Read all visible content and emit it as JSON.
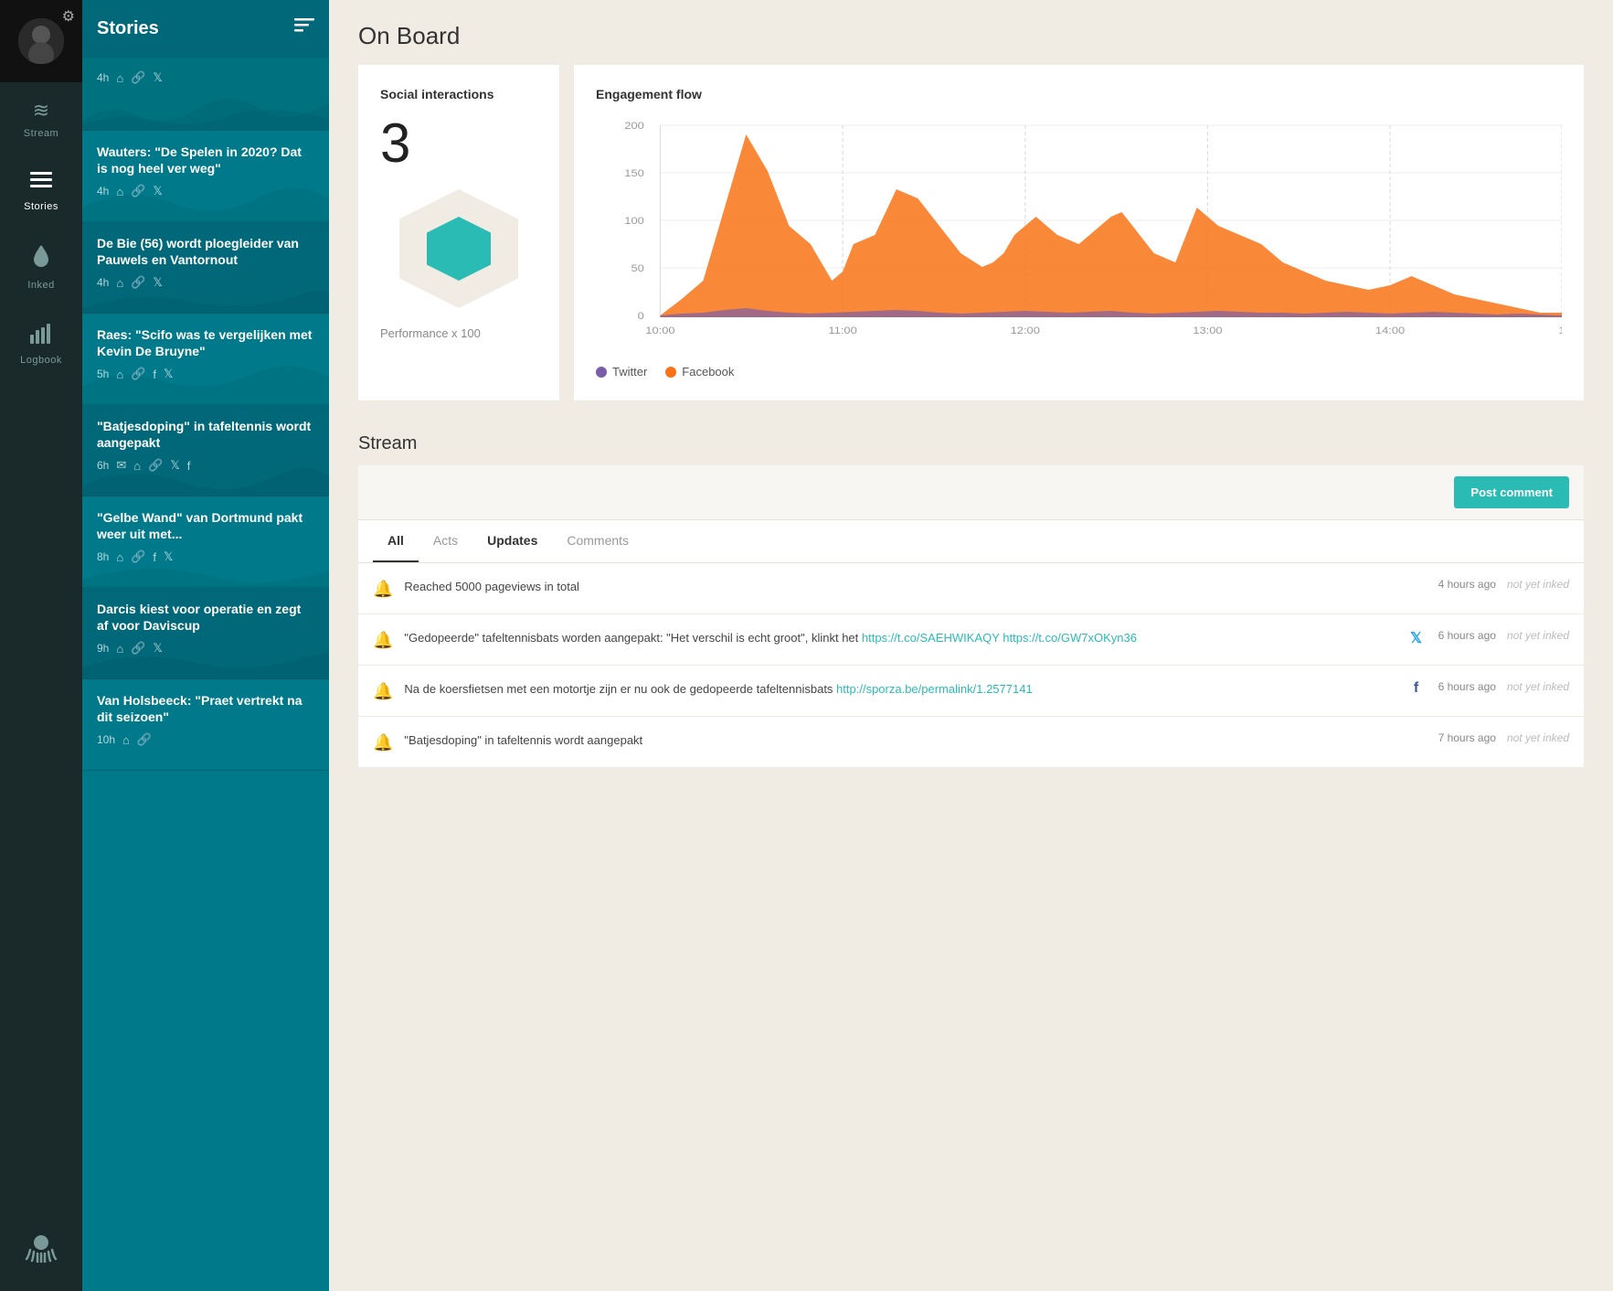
{
  "app": {
    "title": "On Board"
  },
  "nav": {
    "items": [
      {
        "id": "stream",
        "label": "Stream",
        "icon": "≋",
        "active": false
      },
      {
        "id": "stories",
        "label": "Stories",
        "icon": "☰",
        "active": true
      },
      {
        "id": "inked",
        "label": "Inked",
        "icon": "💧",
        "active": false
      },
      {
        "id": "logbook",
        "label": "Logbook",
        "icon": "📊",
        "active": false
      }
    ],
    "brand_icon": "🐙"
  },
  "stories": {
    "header": "Stories",
    "items": [
      {
        "id": 1,
        "title": "",
        "time": "4h",
        "icons": [
          "home",
          "link",
          "twitter"
        ],
        "active": true
      },
      {
        "id": 2,
        "title": "Wauters: \"De Spelen in 2020? Dat is nog heel ver weg\"",
        "time": "4h",
        "icons": [
          "home",
          "link",
          "twitter"
        ]
      },
      {
        "id": 3,
        "title": "De Bie (56) wordt ploegleider van Pauwels en Vantornout",
        "time": "4h",
        "icons": [
          "home",
          "link",
          "twitter"
        ]
      },
      {
        "id": 4,
        "title": "Raes: \"Scifo was te vergelijken met Kevin De Bruyne\"",
        "time": "5h",
        "icons": [
          "home",
          "link",
          "facebook",
          "twitter"
        ]
      },
      {
        "id": 5,
        "title": "\"Batjesdoping\" in tafeltennis wordt aangepakt",
        "time": "6h",
        "icons": [
          "email",
          "home",
          "link",
          "twitter",
          "facebook"
        ]
      },
      {
        "id": 6,
        "title": "\"Gelbe Wand\" van Dortmund pakt weer uit met...",
        "time": "8h",
        "icons": [
          "home",
          "link",
          "facebook",
          "twitter"
        ]
      },
      {
        "id": 7,
        "title": "Darcis kiest voor operatie en zegt af voor Daviscup",
        "time": "9h",
        "icons": [
          "home",
          "link",
          "twitter"
        ]
      },
      {
        "id": 8,
        "title": "Van Holsbeeck: \"Praet vertrekt na dit seizoen\"",
        "time": "10h",
        "icons": [
          "home",
          "link"
        ]
      }
    ]
  },
  "social_interactions": {
    "title": "Social interactions",
    "number": "3",
    "label": "Performance x 100"
  },
  "engagement_flow": {
    "title": "Engagement flow",
    "legend": {
      "twitter": {
        "label": "Twitter",
        "color": "#7b5ea7"
      },
      "facebook": {
        "label": "Facebook",
        "color": "#f97316"
      }
    },
    "y_labels": [
      "200",
      "150",
      "100",
      "50",
      "0"
    ],
    "x_labels": [
      "10:00",
      "11:00",
      "12:00",
      "13:00",
      "14:00"
    ]
  },
  "stream": {
    "title": "Stream",
    "post_comment_label": "Post comment",
    "tabs": [
      {
        "id": "all",
        "label": "All",
        "active": true
      },
      {
        "id": "acts",
        "label": "Acts",
        "active": false
      },
      {
        "id": "updates",
        "label": "Updates",
        "active": false,
        "bold": true
      },
      {
        "id": "comments",
        "label": "Comments",
        "active": false
      }
    ],
    "entries": [
      {
        "id": 1,
        "text": "Reached 5000 pageviews in total",
        "source": "",
        "time": "4 hours ago",
        "inked": "not yet inked",
        "link": ""
      },
      {
        "id": 2,
        "text": "\"Gedopeerde\" tafeltennisbats worden aangepakt: \"Het verschil is echt groot\", klinkt het",
        "link1": "https://t.co/SAEHWIKAQY",
        "link2": "https://t.co/GW7xOKyn36",
        "source": "twitter",
        "time": "6 hours ago",
        "inked": "not yet inked"
      },
      {
        "id": 3,
        "text": "Na de koersfietsen met een motortje zijn er nu ook de gedopeerde tafeltennisbats",
        "link1": "http://sporza.be/permalink/1.2577141",
        "source": "facebook",
        "time": "6 hours ago",
        "inked": "not yet inked"
      },
      {
        "id": 4,
        "text": "\"Batjesdoping\" in tafeltennis wordt aangepakt",
        "source": "",
        "time": "7 hours ago",
        "inked": "not yet inked",
        "link": ""
      }
    ]
  }
}
